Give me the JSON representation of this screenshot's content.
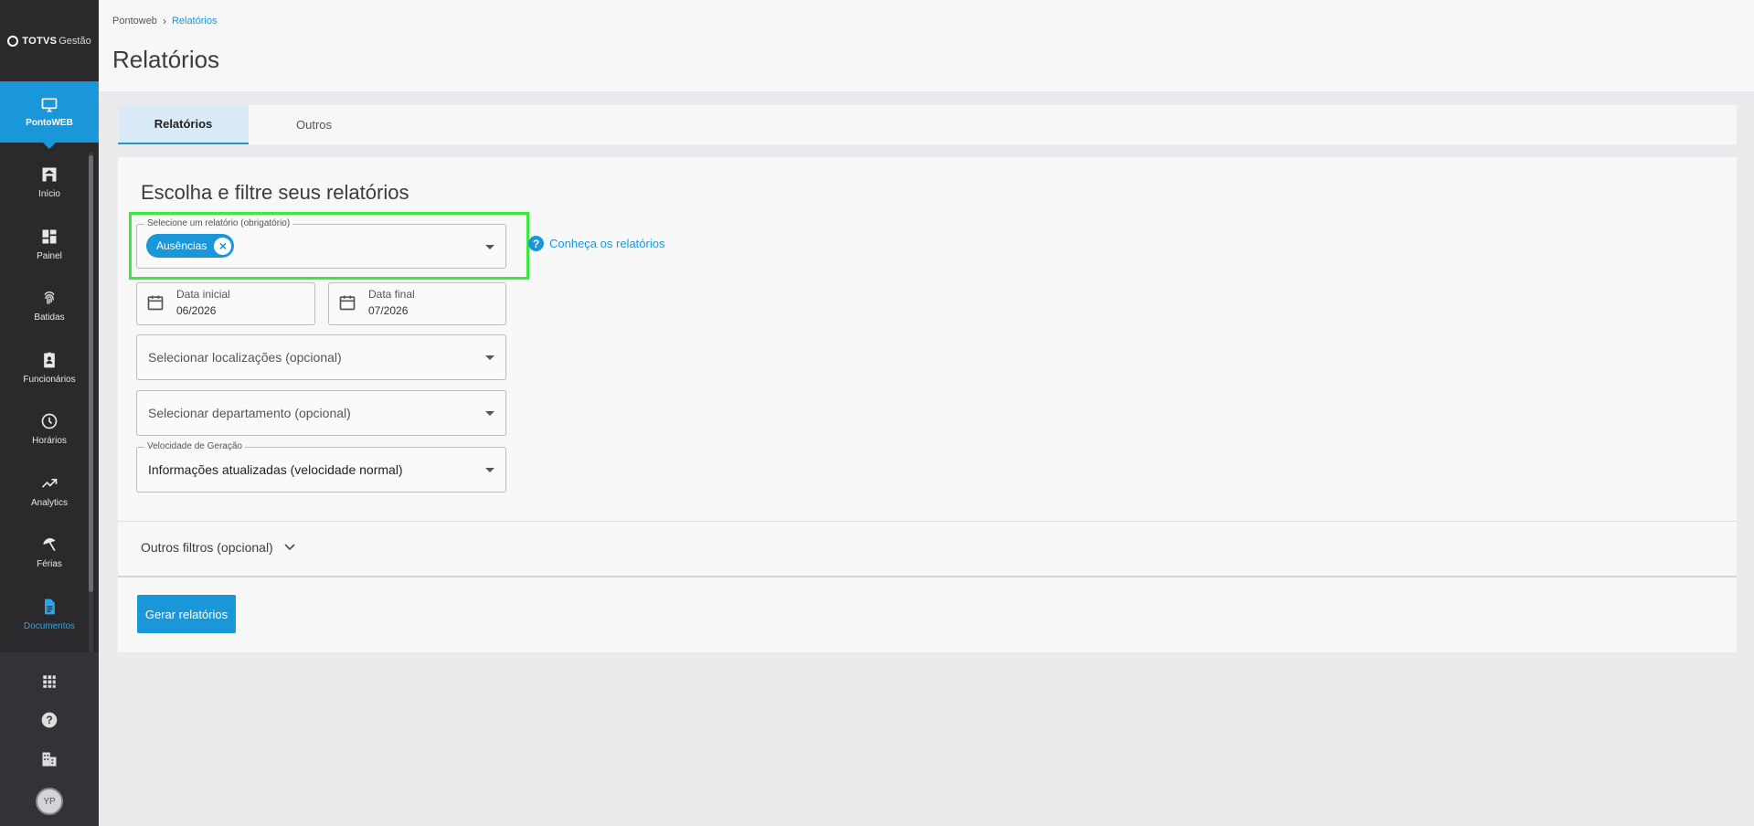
{
  "sidebar": {
    "logo": {
      "brand": "TOTVS",
      "product": "Gestão"
    },
    "app": {
      "label": "PontoWEB",
      "icon": "monitor-icon"
    },
    "items": [
      {
        "label": "Início",
        "icon": "home-icon"
      },
      {
        "label": "Painel",
        "icon": "dashboard-icon"
      },
      {
        "label": "Batidas",
        "icon": "fingerprint-icon"
      },
      {
        "label": "Funcionários",
        "icon": "badge-icon"
      },
      {
        "label": "Horários",
        "icon": "clock-icon"
      },
      {
        "label": "Analytics",
        "icon": "trending-up-icon"
      },
      {
        "label": "Férias",
        "icon": "beach-umbrella-icon"
      },
      {
        "label": "Documentos",
        "icon": "document-icon"
      }
    ],
    "bottom": {
      "apps_icon": "apps-grid-icon",
      "help_icon": "help-icon",
      "company_icon": "building-icon",
      "avatar_initials": "YP"
    }
  },
  "header": {
    "breadcrumb": [
      "Pontoweb",
      "Relatórios"
    ],
    "title": "Relatórios"
  },
  "tabs": [
    {
      "label": "Relatórios",
      "selected": true
    },
    {
      "label": "Outros",
      "selected": false
    }
  ],
  "form": {
    "title": "Escolha e filtre seus relatórios",
    "report_select": {
      "legend": "Selecione um relatório (obrigatório)",
      "chip": "Ausências"
    },
    "help_link": "Conheça os relatórios",
    "start_date": {
      "label": "Data inicial",
      "value": "06/2026"
    },
    "end_date": {
      "label": "Data final",
      "value": "07/2026"
    },
    "locations_placeholder": "Selecionar localizações (opcional)",
    "department_placeholder": "Selecionar departamento (opcional)",
    "speed": {
      "legend": "Velocidade de Geração",
      "value": "Informações atualizadas (velocidade normal)"
    },
    "other_filters": "Outros filtros (opcional)",
    "generate_button": "Gerar relatórios"
  },
  "colors": {
    "accent": "#1a97d9",
    "sidebar": "#2a2a2d",
    "highlight": "#3ce83c"
  }
}
